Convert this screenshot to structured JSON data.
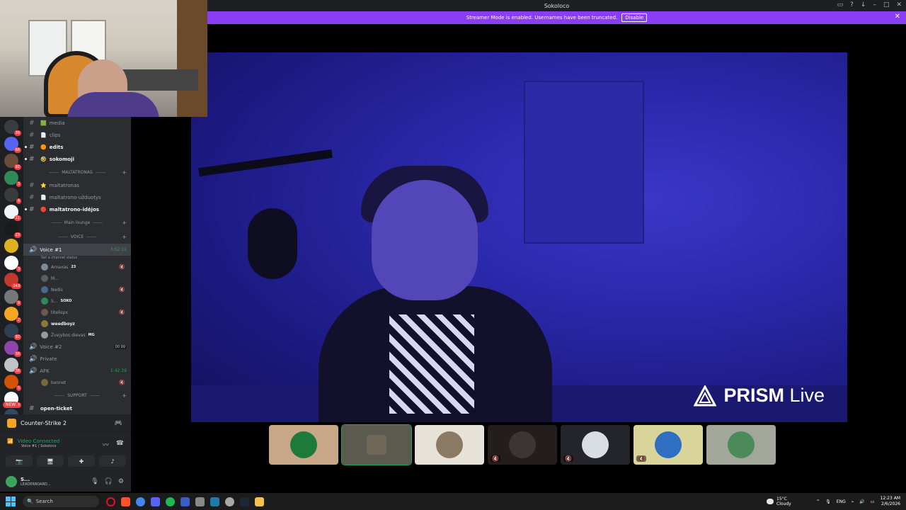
{
  "window": {
    "title": "Sokoloco"
  },
  "streamer_mode": {
    "message": "Streamer Mode is enabled. Usernames have been truncated.",
    "disable_label": "Disable"
  },
  "server_badges": [
    "39",
    "68",
    "92",
    "3",
    "4",
    "11",
    "23",
    "",
    "3",
    "143",
    "9",
    "2",
    "92",
    "38",
    "38",
    "5",
    "44",
    "20"
  ],
  "new_label": "NEW",
  "channels": [
    {
      "name": "media",
      "emoji": "🟩",
      "bold": false
    },
    {
      "name": "clips",
      "emoji": "📄",
      "bold": false
    },
    {
      "name": "edits",
      "emoji": "🟠",
      "bold": true
    },
    {
      "name": "sokomoji",
      "emoji": "🤣",
      "bold": true
    }
  ],
  "category_maltatronas": "MALTATRONAS",
  "maltatronas_channels": [
    {
      "name": "maltatronas",
      "emoji": "⭐",
      "bold": false
    },
    {
      "name": "maltatrono-užduotys",
      "emoji": "📄",
      "bold": false
    },
    {
      "name": "maltatrono-idėjos",
      "emoji": "🔴",
      "bold": true
    }
  ],
  "category_main_lounge": "Main lounge",
  "category_voice": "VOICE",
  "voice1": {
    "name": "Voice #1",
    "timer": "3:52:11",
    "status": "Set a channel status"
  },
  "voice_members": [
    {
      "name": "Arnaxas",
      "tag": "23",
      "bold": false,
      "muted": true
    },
    {
      "name": "M...",
      "tag": "",
      "bold": false,
      "muted": false
    },
    {
      "name": "Nedis",
      "tag": "",
      "bold": false,
      "muted": true
    },
    {
      "name": "S...",
      "tag": "SOKO",
      "bold": false,
      "muted": false
    },
    {
      "name": "titelispx",
      "tag": "",
      "bold": false,
      "muted": true
    },
    {
      "name": "weedboyz",
      "tag": "",
      "bold": true,
      "muted": false
    },
    {
      "name": "Žvejybos dievas",
      "tag": "MG",
      "bold": false,
      "muted": false
    }
  ],
  "voice2": {
    "name": "Voice #2",
    "count": "00 99"
  },
  "private": {
    "name": "Private"
  },
  "afk": {
    "name": "AFK",
    "timer": "1:42:19",
    "member": "bannet"
  },
  "category_support": "SUPPORT",
  "support_channel": "open-ticket",
  "activity": {
    "game": "Counter-Strike 2"
  },
  "voice_connected": {
    "title": "Video Connected",
    "sub": "Voice #1 / Sokoloco"
  },
  "user": {
    "name": "S...",
    "status": "LEADERBOARD..."
  },
  "prism": {
    "label_bold": "PRISM",
    "label": "Live"
  },
  "taskbar": {
    "search": "Search",
    "weather_temp": "15°C",
    "weather_desc": "Cloudy",
    "lang": "ENG",
    "time": "12:23 AM",
    "date": "2/6/2026"
  }
}
